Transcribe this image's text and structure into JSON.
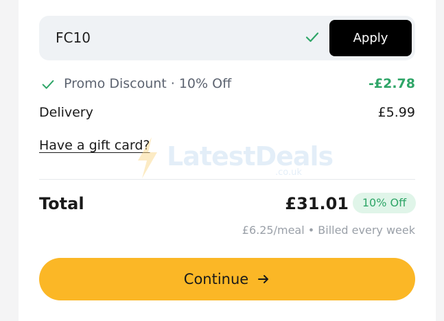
{
  "promo": {
    "code": "FC10",
    "apply_label": "Apply",
    "discount_label": "Promo Discount · 10% Off",
    "discount_value": "-£2.78"
  },
  "delivery": {
    "label": "Delivery",
    "value": "£5.99"
  },
  "gift_card_link": "Have a gift card?",
  "watermark": {
    "text": "LatestDeals",
    "sub": ".co.uk"
  },
  "total": {
    "label": "Total",
    "amount": "£31.01",
    "badge": "10% Off",
    "billing_note": "£6.25/meal • Billed every week"
  },
  "continue_label": "Continue",
  "colors": {
    "accent": "#fbb726",
    "success": "#2ea567",
    "badge_bg": "#e0f5e9",
    "apply_bg": "#000000"
  },
  "icons": {
    "promo_valid": "check-icon",
    "discount": "check-icon",
    "continue": "arrow-right-icon"
  }
}
